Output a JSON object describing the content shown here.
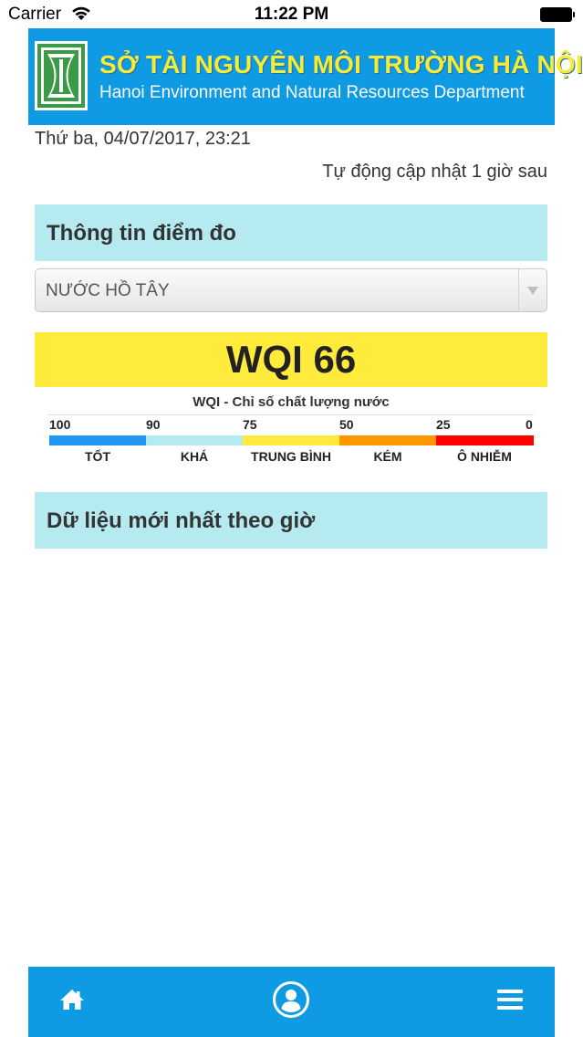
{
  "status_bar": {
    "carrier": "Carrier",
    "time": "11:22 PM"
  },
  "header": {
    "title": "SỞ TÀI NGUYÊN MÔI TRƯỜNG HÀ NỘI",
    "subtitle": "Hanoi Environment and Natural Resources Department",
    "logo_icon": "department-logo-icon"
  },
  "datetime": "Thứ ba, 04/07/2017, 23:21",
  "auto_update": "Tự động cập nhật 1 giờ sau",
  "station_section": {
    "title": "Thông tin điểm đo",
    "selected_station": "NƯỚC HỒ TÂY"
  },
  "wqi": {
    "label": "WQI 66",
    "value": 66,
    "scale_title": "WQI - Chỉ số chất lượng nước",
    "scale_numbers": [
      "100",
      "90",
      "75",
      "50",
      "25",
      "0"
    ],
    "categories": [
      {
        "label": "TỐT",
        "color": "#2196f3"
      },
      {
        "label": "KHÁ",
        "color": "#b4eaf0"
      },
      {
        "label": "TRUNG BÌNH",
        "color": "#ffeb3b"
      },
      {
        "label": "KÉM",
        "color": "#ff9800"
      },
      {
        "label": "Ô NHIỄM",
        "color": "#ff0000"
      }
    ]
  },
  "hourly_section": {
    "title": "Dữ liệu mới nhất theo giờ"
  },
  "tab_bar": {
    "items": [
      {
        "icon": "home-icon"
      },
      {
        "icon": "user-profile-icon"
      },
      {
        "icon": "menu-icon"
      }
    ]
  },
  "colors": {
    "brand_blue": "#0f9ae4",
    "title_yellow": "#f4ec36",
    "section_bg": "#b4eaf0",
    "wqi_banner": "#ffeb3b"
  }
}
